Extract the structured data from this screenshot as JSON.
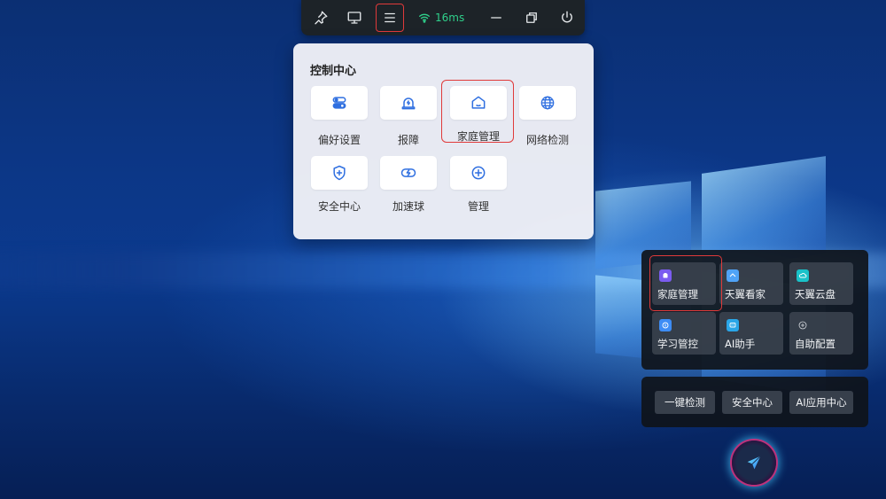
{
  "toolbar": {
    "pin_icon": "pin-icon",
    "screen_icon": "monitor-icon",
    "menu_icon": "hamburger-menu-icon",
    "latency": "16ms",
    "minimize_icon": "minimize-icon",
    "restore_icon": "restore-icon",
    "power_icon": "power-icon",
    "accent_green": "#2fd08b"
  },
  "control_center": {
    "title": "控制中心",
    "items": [
      {
        "label": "偏好设置",
        "icon": "toggle-settings-icon"
      },
      {
        "label": "报障",
        "icon": "alarm-icon"
      },
      {
        "label": "家庭管理",
        "icon": "home-icon"
      },
      {
        "label": "网络检测",
        "icon": "globe-icon"
      },
      {
        "label": "安全中心",
        "icon": "shield-icon"
      },
      {
        "label": "加速球",
        "icon": "accelerator-icon"
      },
      {
        "label": "管理",
        "icon": "plus-circle-icon"
      }
    ],
    "icon_color": "#2f6fe0"
  },
  "apps": [
    {
      "label": "家庭管理",
      "icon": "home-app-icon",
      "color": "#7b5cf0"
    },
    {
      "label": "天翼看家",
      "icon": "camera-app-icon",
      "color": "#4fa3f7"
    },
    {
      "label": "天翼云盘",
      "icon": "cloud-app-icon",
      "color": "#19c2c9"
    },
    {
      "label": "学习管控",
      "icon": "study-app-icon",
      "color": "#3d8cf5"
    },
    {
      "label": "AI助手",
      "icon": "ai-app-icon",
      "color": "#2aa6e8"
    },
    {
      "label": "自助配置",
      "icon": "plus-circle-icon",
      "color": "#9aa3ad"
    }
  ],
  "quick_actions": [
    "一键检测",
    "安全中心",
    "AI应用中心"
  ],
  "fab_icon": "send-icon",
  "highlight_color": "#e03a3a"
}
